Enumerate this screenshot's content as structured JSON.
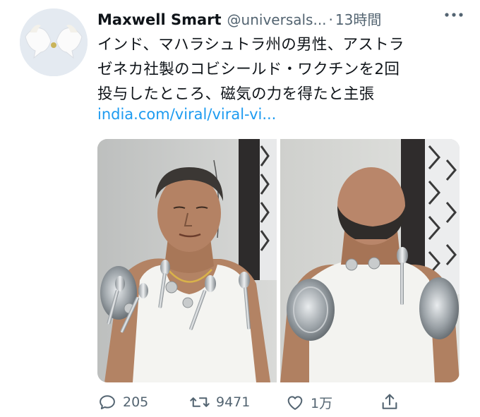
{
  "tweet": {
    "author_name": "Maxwell Smart",
    "handle": "@universals...",
    "separator": "·",
    "time": "13時間",
    "text_lines": [
      "インド、マハラシュトラ州の男性、アストラ",
      "ゼネカ社製のコビシールド・ワクチンを2回",
      "投与したところ、磁気の力を得たと主張"
    ],
    "link": "india.com/viral/viral-vi...",
    "link_color": "#1d9bf0"
  },
  "icons": {
    "more": "more-icon",
    "reply": "reply-icon",
    "retweet": "retweet-icon",
    "like": "like-icon",
    "share": "share-icon"
  },
  "actions": {
    "reply_count": "205",
    "retweet_count": "9471",
    "like_count": "1万"
  }
}
